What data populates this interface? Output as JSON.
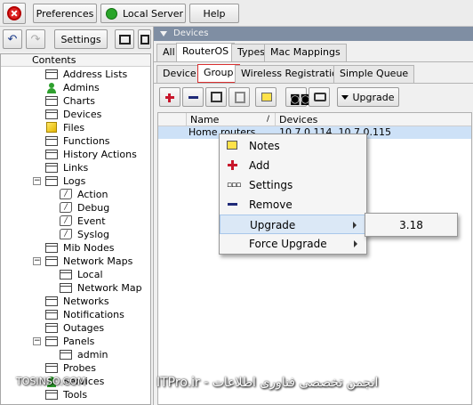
{
  "toolbar": {
    "preferences": "Preferences",
    "local_server": "Local Server",
    "help": "Help",
    "settings": "Settings"
  },
  "tree": {
    "header": "Contents",
    "items": [
      {
        "label": "Address Lists"
      },
      {
        "label": "Admins"
      },
      {
        "label": "Charts"
      },
      {
        "label": "Devices"
      },
      {
        "label": "Files"
      },
      {
        "label": "Functions"
      },
      {
        "label": "History Actions"
      },
      {
        "label": "Links"
      },
      {
        "label": "Logs"
      },
      {
        "label": "Action"
      },
      {
        "label": "Debug"
      },
      {
        "label": "Event"
      },
      {
        "label": "Syslog"
      },
      {
        "label": "Mib Nodes"
      },
      {
        "label": "Network Maps"
      },
      {
        "label": "Local"
      },
      {
        "label": "Network Map"
      },
      {
        "label": "Networks"
      },
      {
        "label": "Notifications"
      },
      {
        "label": "Outages"
      },
      {
        "label": "Panels"
      },
      {
        "label": "admin"
      },
      {
        "label": "Probes"
      },
      {
        "label": "Services"
      },
      {
        "label": "Tools"
      }
    ]
  },
  "panel": {
    "title": "Devices",
    "tabs": [
      "All",
      "RouterOS",
      "Types",
      "Mac Mappings"
    ],
    "subtabs": [
      "Device",
      "Group",
      "Wireless Registration",
      "Simple Queue"
    ],
    "upgrade_button": "Upgrade",
    "columns": [
      "Name",
      "Devices"
    ],
    "rows": [
      {
        "name": "Home routers",
        "devices": "10.7.0.114, 10.7.0.115"
      }
    ]
  },
  "menu": {
    "items": [
      "Notes",
      "Add",
      "Settings",
      "Remove",
      "Upgrade",
      "Force Upgrade"
    ],
    "submenu": [
      "3.18"
    ]
  },
  "watermark": {
    "left": "TOSINSO.COM",
    "right": "ITPro.ir - انجمن تخصصی فناوری اطلاعات"
  },
  "colors": {
    "title_bar": "#7f8ea3",
    "selected_row": "#cde1f7",
    "add": "#c8162b",
    "remove": "#1f2a78"
  }
}
